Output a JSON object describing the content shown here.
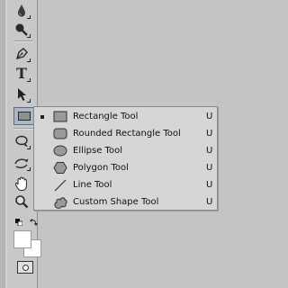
{
  "toolbar": {
    "tools": [
      {
        "name": "blur-tool",
        "icon": "drop-icon"
      },
      {
        "name": "dodge-tool",
        "icon": "dodge-icon"
      },
      {
        "name": "pen-tool",
        "icon": "pen-icon"
      },
      {
        "name": "type-tool",
        "icon": "type-icon",
        "label": "T"
      },
      {
        "name": "path-selection-tool",
        "icon": "arrow-cursor-icon"
      },
      {
        "name": "rectangle-tool",
        "icon": "rectangle-icon",
        "selected": true
      },
      {
        "name": "3d-rotate-tool",
        "icon": "3d-rotate-icon"
      },
      {
        "name": "3d-orbit-tool",
        "icon": "3d-orbit-icon"
      },
      {
        "name": "hand-tool",
        "icon": "hand-icon"
      },
      {
        "name": "zoom-tool",
        "icon": "magnifier-icon"
      }
    ],
    "foreground_color": "#ffffff",
    "background_color": "#ffffff"
  },
  "flyout": {
    "items": [
      {
        "label": "Rectangle Tool",
        "shortcut": "U",
        "icon": "rectangle-icon",
        "active": true
      },
      {
        "label": "Rounded Rectangle Tool",
        "shortcut": "U",
        "icon": "rounded-rectangle-icon"
      },
      {
        "label": "Ellipse Tool",
        "shortcut": "U",
        "icon": "ellipse-icon"
      },
      {
        "label": "Polygon Tool",
        "shortcut": "U",
        "icon": "polygon-icon"
      },
      {
        "label": "Line Tool",
        "shortcut": "U",
        "icon": "line-icon"
      },
      {
        "label": "Custom Shape Tool",
        "shortcut": "U",
        "icon": "custom-shape-icon"
      }
    ]
  },
  "colors": {
    "panel": "#c8c8c8",
    "flyout_bg": "#d6d6d6",
    "selected_tool_bg": "#a9b7c6"
  }
}
